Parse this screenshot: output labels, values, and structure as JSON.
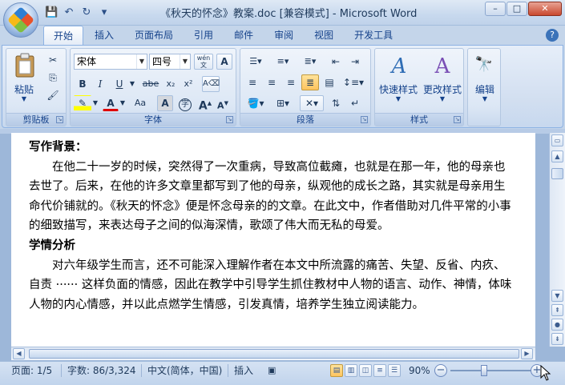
{
  "window": {
    "title": "《秋天的怀念》教案.doc [兼容模式] - Microsoft Word",
    "minimize": "–",
    "maximize": "□",
    "close": "✕"
  },
  "qat": [
    "save-icon",
    "undo-icon",
    "redo-icon",
    "customize-icon"
  ],
  "tabs": [
    {
      "label": "开始",
      "active": true
    },
    {
      "label": "插入"
    },
    {
      "label": "页面布局"
    },
    {
      "label": "引用"
    },
    {
      "label": "邮件"
    },
    {
      "label": "审阅"
    },
    {
      "label": "视图"
    },
    {
      "label": "开发工具"
    }
  ],
  "ribbon": {
    "clipboard": {
      "label": "剪贴板",
      "paste": "粘贴"
    },
    "font": {
      "label": "字体",
      "font_name": "宋体",
      "font_size": "四号",
      "bold": "B",
      "italic": "I",
      "underline": "U",
      "strike": "abe",
      "subscript": "x₂",
      "superscript": "x²",
      "grow": "A",
      "shrink": "A",
      "case": "Aa",
      "char_border": "A",
      "phonetic": "字",
      "wen": "wén",
      "text_color": "A"
    },
    "paragraph": {
      "label": "段落"
    },
    "styles": {
      "label": "样式",
      "quick_styles": "快速样式",
      "change_styles": "更改样式"
    },
    "editing": {
      "label": "编辑"
    }
  },
  "document": {
    "heading1": "写作背景：",
    "para1": "在他二十一岁的时候，突然得了一次重病，导致高位截瘫，也就是在那一年，他的母亲也去世了。后来，在他的许多文章里都写到了他的母亲，纵观他的成长之路，其实就是母亲用生命代价铺就的。《秋天的怀念》便是怀念母亲的的文章。在此文中，作者借助对几件平常的小事的细致描写，来表达母子之间的似海深情，歌颂了伟大而无私的母爱。",
    "heading2": "学情分析",
    "para2": "对六年级学生而言，还不可能深入理解作者在本文中所流露的痛苦、失望、反省、内疚、自责 ······ 这样负面的情感，因此在教学中引导学生抓住教材中人物的语言、动作、神情，体味人物的内心情感，并以此点燃学生情感，引发真情，培养学生独立阅读能力。"
  },
  "statusbar": {
    "page": "页面: 1/5",
    "words": "字数: 86/3,324",
    "language": "中文(简体，中国)",
    "insert_mode": "插入",
    "zoom": "90%",
    "zoom_minus": "−",
    "zoom_plus": "+"
  },
  "colors": {
    "accent": "#15428b",
    "ribbon_bg": "#dce7f5",
    "highlight": "#ffc45e"
  }
}
